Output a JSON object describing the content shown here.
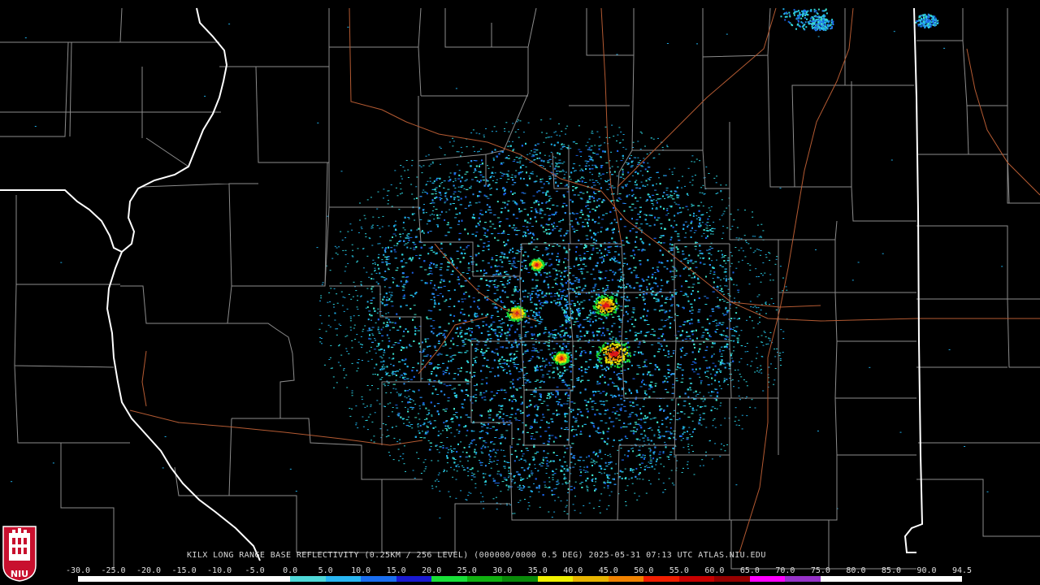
{
  "caption": {
    "site": "KILX",
    "product": "LONG RANGE BASE REFLECTIVITY",
    "resolution": "(0.25KM / 256 LEVEL)",
    "volume": "(000000/0000 0.5 DEG)",
    "date": "2025-05-31",
    "time": "07:13 UTC",
    "source": "ATLAS.NIU.EDU"
  },
  "colors": {
    "background": "#000000",
    "county_lines": "#8c8c8c",
    "state_lines": "#ffffff",
    "highways": "#b45a32",
    "caption_text": "#d8d8d8"
  },
  "color_scale": {
    "labels": [
      "-30.0",
      "-25.0",
      "-20.0",
      "-15.0",
      "-10.0",
      "-5.0",
      "0.0",
      "5.0",
      "10.0",
      "15.0",
      "20.0",
      "25.0",
      "30.0",
      "35.0",
      "40.0",
      "45.0",
      "50.0",
      "55.0",
      "60.0",
      "65.0",
      "70.0",
      "75.0",
      "80.0",
      "85.0",
      "90.0",
      "94.5"
    ],
    "segment_colors": [
      "#ffffff",
      "#ffffff",
      "#ffffff",
      "#ffffff",
      "#ffffff",
      "#ffffff",
      "#4fd8d8",
      "#29b6f2",
      "#1a6ef0",
      "#1a1ad2",
      "#18e038",
      "#10b010",
      "#0a8a0a",
      "#f0f000",
      "#e8b400",
      "#f08200",
      "#f01e00",
      "#c80000",
      "#960000",
      "#ff00ff",
      "#9632c8",
      "#ffffff",
      "#ffffff",
      "#ffffff",
      "#ffffff"
    ]
  },
  "radar": {
    "site_label": "KILX",
    "echo_colors": [
      "#2fd6e0",
      "#1faee8",
      "#2a8ef0",
      "#3fe0c8",
      "#1a60e0"
    ],
    "heavy_echo_colors": [
      "#18d838",
      "#e8e000",
      "#f08a00",
      "#e01818"
    ]
  },
  "logo": {
    "text": "NIU",
    "colors": [
      "#c8102e",
      "#ffffff"
    ]
  }
}
